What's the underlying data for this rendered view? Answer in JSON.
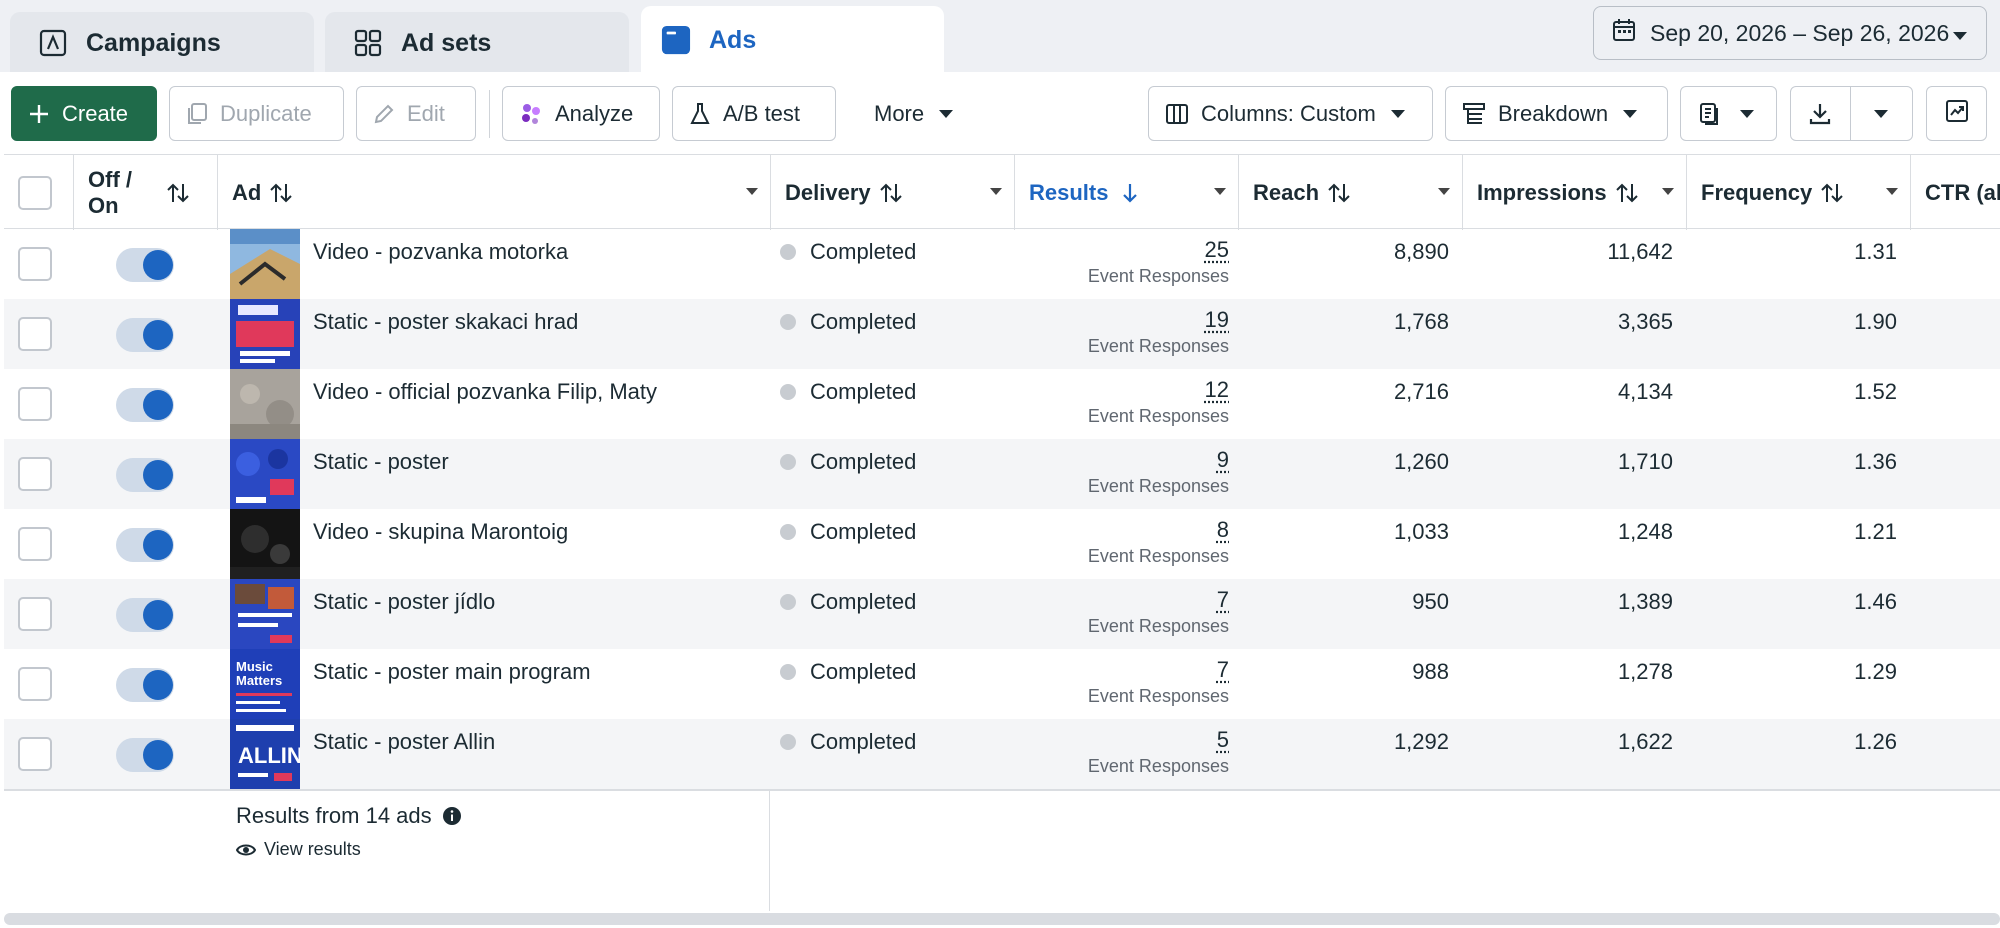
{
  "tabs": [
    {
      "label": "Campaigns",
      "icon": "campaign-flag-icon"
    },
    {
      "label": "Ad sets",
      "icon": "grid-icon"
    },
    {
      "label": "Ads",
      "icon": "ad-window-icon",
      "active": true
    }
  ],
  "date_range": "Sep 20, 2026 – Sep 26, 2026",
  "toolbar": {
    "create": "Create",
    "duplicate": "Duplicate",
    "edit": "Edit",
    "analyze": "Analyze",
    "ab_test": "A/B test",
    "more": "More",
    "columns": "Columns: Custom",
    "breakdown": "Breakdown"
  },
  "columns": {
    "off_on": "Off / On",
    "ad": "Ad",
    "delivery": "Delivery",
    "results": "Results",
    "reach": "Reach",
    "impressions": "Impressions",
    "frequency": "Frequency",
    "ctr": "CTR (all"
  },
  "rows": [
    {
      "name": "Video - pozvanka motorka",
      "delivery": "Completed",
      "results": "25",
      "results_unit": "Event Responses",
      "reach": "8,890",
      "impressions": "11,642",
      "frequency": "1.31",
      "on": true
    },
    {
      "name": "Static - poster skakaci hrad",
      "delivery": "Completed",
      "results": "19",
      "results_unit": "Event Responses",
      "reach": "1,768",
      "impressions": "3,365",
      "frequency": "1.90",
      "on": true
    },
    {
      "name": "Video - official pozvanka Filip, Maty",
      "delivery": "Completed",
      "results": "12",
      "results_unit": "Event Responses",
      "reach": "2,716",
      "impressions": "4,134",
      "frequency": "1.52",
      "on": true
    },
    {
      "name": "Static - poster",
      "delivery": "Completed",
      "results": "9",
      "results_unit": "Event Responses",
      "reach": "1,260",
      "impressions": "1,710",
      "frequency": "1.36",
      "on": true
    },
    {
      "name": "Video - skupina Marontoig",
      "delivery": "Completed",
      "results": "8",
      "results_unit": "Event Responses",
      "reach": "1,033",
      "impressions": "1,248",
      "frequency": "1.21",
      "on": true
    },
    {
      "name": "Static - poster jídlo",
      "delivery": "Completed",
      "results": "7",
      "results_unit": "Event Responses",
      "reach": "950",
      "impressions": "1,389",
      "frequency": "1.46",
      "on": true
    },
    {
      "name": "Static - poster main program",
      "delivery": "Completed",
      "results": "7",
      "results_unit": "Event Responses",
      "reach": "988",
      "impressions": "1,278",
      "frequency": "1.29",
      "on": true
    },
    {
      "name": "Static - poster Allin",
      "delivery": "Completed",
      "results": "5",
      "results_unit": "Event Responses",
      "reach": "1,292",
      "impressions": "1,622",
      "frequency": "1.26",
      "on": true
    }
  ],
  "thumb_text": {
    "r7": "Music Matters",
    "r8": "ALLIN"
  },
  "footer": {
    "title": "Results from 14 ads",
    "link": "View results"
  },
  "colors": {
    "accent": "#1d65c1",
    "create": "#1f6b4a"
  }
}
